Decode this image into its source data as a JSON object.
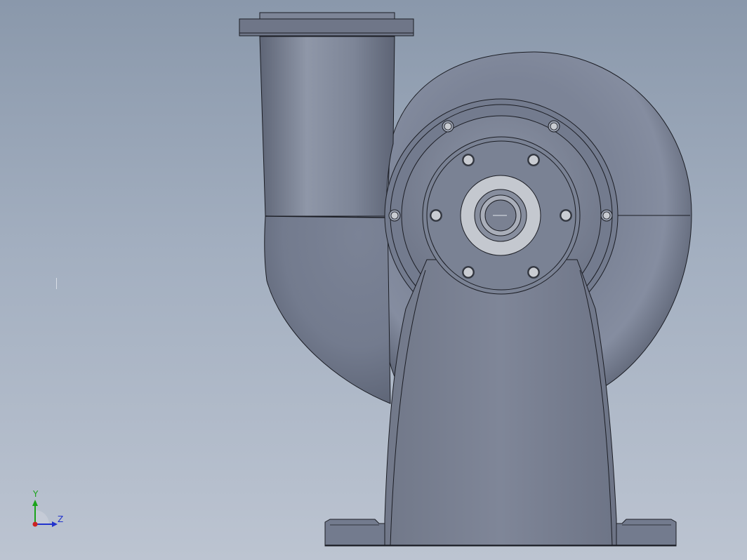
{
  "viewport": {
    "background_top": "#8a98ab",
    "background_bottom": "#bcc4d1"
  },
  "model": {
    "body_color": "#777f91",
    "edge_color": "#1b1d24",
    "bore_color": "#c9ccd2"
  },
  "triad": {
    "y_label": "Y",
    "z_label": "Z",
    "y_color": "#1aa31a",
    "z_color": "#2233cc",
    "x_color": "#cc2222"
  }
}
